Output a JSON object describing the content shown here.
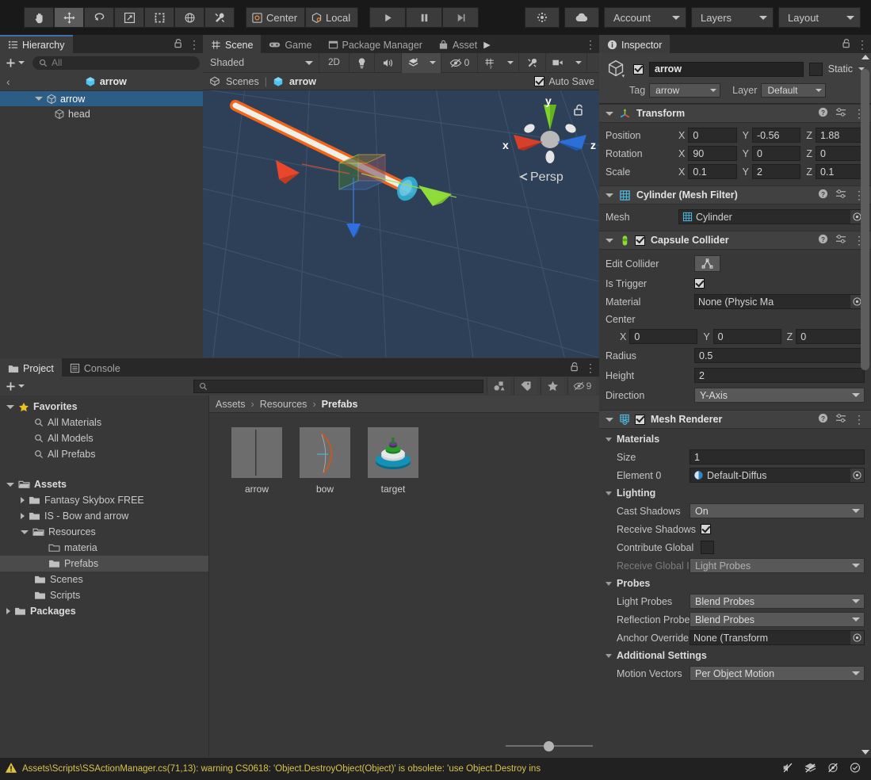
{
  "toolbar": {
    "tools": [
      {
        "name": "hand-tool",
        "icon": "hand",
        "active": false
      },
      {
        "name": "move-tool",
        "icon": "move",
        "active": true
      },
      {
        "name": "rotate-tool",
        "icon": "rotate",
        "active": false
      },
      {
        "name": "scale-tool",
        "icon": "scale",
        "active": false
      },
      {
        "name": "rect-tool",
        "icon": "rect",
        "active": false
      },
      {
        "name": "transform-tool",
        "icon": "transform",
        "active": false
      },
      {
        "name": "custom-tool",
        "icon": "wrench",
        "active": false
      }
    ],
    "pivot_label": "Center",
    "handle_label": "Local",
    "play_label": "play",
    "pause_label": "pause",
    "step_label": "step",
    "collab_label": "collab",
    "cloud_label": "cloud",
    "account_label": "Account",
    "layers_label": "Layers",
    "layout_label": "Layout"
  },
  "hierarchy": {
    "tab_label": "Hierarchy",
    "create_label": "+",
    "search_placeholder": "All",
    "breadcrumb_label": "arrow",
    "items": [
      {
        "label": "arrow",
        "depth": 1,
        "selected": true,
        "expanded": true
      },
      {
        "label": "head",
        "depth": 2,
        "selected": false,
        "expanded": false
      }
    ]
  },
  "scene": {
    "tabs": [
      {
        "label": "Scene",
        "icon": "grid-icon",
        "active": true
      },
      {
        "label": "Game",
        "icon": "gamepad-icon",
        "active": false
      },
      {
        "label": "Package Manager",
        "icon": "package-icon",
        "active": false
      },
      {
        "label": "Asset",
        "icon": "store-icon",
        "active": false
      }
    ],
    "draw_mode": "Shaded",
    "mode_2d": "2D",
    "gizmo_count": "0",
    "breadcrumb_scenes": "Scenes",
    "breadcrumb_scene_name": "arrow",
    "autosave_label": "Auto Save",
    "autosave_checked": true,
    "axis_x": "x",
    "axis_y": "y",
    "axis_z": "z",
    "persp_label": "Persp",
    "background": "#2d4057"
  },
  "inspector": {
    "tab_label": "Inspector",
    "object_name": "arrow",
    "object_enabled": true,
    "static_label": "Static",
    "tag_label": "Tag",
    "tag_value": "arrow",
    "layer_label": "Layer",
    "layer_value": "Default",
    "components": [
      {
        "title": "Transform",
        "icon": "transform-icon",
        "has_checkbox": false,
        "rows": [
          {
            "kind": "vector3",
            "label": "Position",
            "x": "0",
            "y": "-0.56",
            "z": "1.88"
          },
          {
            "kind": "vector3",
            "label": "Rotation",
            "x": "90",
            "y": "0",
            "z": "0"
          },
          {
            "kind": "vector3",
            "label": "Scale",
            "x": "0.1",
            "y": "2",
            "z": "0.1"
          }
        ]
      },
      {
        "title": "Cylinder (Mesh Filter)",
        "icon": "mesh-filter-icon",
        "has_checkbox": false,
        "rows": [
          {
            "kind": "object",
            "label": "Mesh",
            "value": "Cylinder"
          }
        ]
      },
      {
        "title": "Capsule Collider",
        "icon": "capsule-collider-icon",
        "has_checkbox": true,
        "checked": true,
        "rows": [
          {
            "kind": "editcollider",
            "label": "Edit Collider"
          },
          {
            "kind": "checkbox",
            "label": "Is Trigger",
            "checked": true
          },
          {
            "kind": "object",
            "label": "Material",
            "value": "None (Physic Ma"
          },
          {
            "kind": "plainlabel",
            "label": "Center"
          },
          {
            "kind": "vector3inset",
            "label": "",
            "x": "0",
            "y": "0",
            "z": "0"
          },
          {
            "kind": "text",
            "label": "Radius",
            "value": "0.5"
          },
          {
            "kind": "text",
            "label": "Height",
            "value": "2"
          },
          {
            "kind": "dropdown",
            "label": "Direction",
            "value": "Y-Axis"
          }
        ]
      },
      {
        "title": "Mesh Renderer",
        "icon": "mesh-renderer-icon",
        "has_checkbox": true,
        "checked": true,
        "rows": [
          {
            "kind": "group",
            "label": "Materials"
          },
          {
            "kind": "text_ind",
            "label": "Size",
            "value": "1"
          },
          {
            "kind": "object_ind",
            "label": "Element 0",
            "value": "Default-Diffus"
          },
          {
            "kind": "group",
            "label": "Lighting"
          },
          {
            "kind": "dropdown_ind",
            "label": "Cast Shadows",
            "value": "On"
          },
          {
            "kind": "checkbox_ind",
            "label": "Receive Shadows",
            "checked": true
          },
          {
            "kind": "checkbox_ind",
            "label": "Contribute Global",
            "checked": false
          },
          {
            "kind": "dropdown_ind_dim",
            "label": "Receive Global Illu",
            "value": "Light Probes"
          },
          {
            "kind": "group",
            "label": "Probes"
          },
          {
            "kind": "dropdown_ind",
            "label": "Light Probes",
            "value": "Blend Probes"
          },
          {
            "kind": "dropdown_ind",
            "label": "Reflection Probes",
            "value": "Blend Probes"
          },
          {
            "kind": "object_ind",
            "label": "Anchor Override",
            "value": "None (Transform"
          },
          {
            "kind": "group",
            "label": "Additional Settings"
          },
          {
            "kind": "dropdown_ind",
            "label": "Motion Vectors",
            "value": "Per Object Motion"
          }
        ]
      }
    ]
  },
  "project": {
    "tabs": [
      {
        "label": "Project",
        "icon": "folder-icon",
        "active": true
      },
      {
        "label": "Console",
        "icon": "console-icon",
        "active": false
      }
    ],
    "create_label": "+",
    "search_placeholder": "",
    "hidden_count": "9",
    "tree": [
      {
        "label": "Favorites",
        "depth": 0,
        "icon": "star",
        "expanded": true,
        "bold": true,
        "selected": false
      },
      {
        "label": "All Materials",
        "depth": 1,
        "icon": "search",
        "expanded": null,
        "bold": false,
        "selected": false
      },
      {
        "label": "All Models",
        "depth": 1,
        "icon": "search",
        "expanded": null,
        "bold": false,
        "selected": false
      },
      {
        "label": "All Prefabs",
        "depth": 1,
        "icon": "search",
        "expanded": null,
        "bold": false,
        "selected": false
      },
      {
        "label": "",
        "depth": 0,
        "icon": "spacer",
        "expanded": null,
        "bold": false,
        "selected": false
      },
      {
        "label": "Assets",
        "depth": 0,
        "icon": "folder-open",
        "expanded": true,
        "bold": true,
        "selected": false
      },
      {
        "label": "Fantasy Skybox FREE",
        "depth": 1,
        "icon": "folder",
        "expanded": false,
        "bold": false,
        "selected": false
      },
      {
        "label": "IS - Bow and arrow",
        "depth": 1,
        "icon": "folder",
        "expanded": false,
        "bold": false,
        "selected": false
      },
      {
        "label": "Resources",
        "depth": 1,
        "icon": "folder-open",
        "expanded": true,
        "bold": false,
        "selected": false
      },
      {
        "label": "materia",
        "depth": 2,
        "icon": "folder-empty",
        "expanded": null,
        "bold": false,
        "selected": false
      },
      {
        "label": "Prefabs",
        "depth": 2,
        "icon": "folder",
        "expanded": null,
        "bold": false,
        "selected": true
      },
      {
        "label": "Scenes",
        "depth": 1,
        "icon": "folder",
        "expanded": null,
        "bold": false,
        "selected": false
      },
      {
        "label": "Scripts",
        "depth": 1,
        "icon": "folder",
        "expanded": null,
        "bold": false,
        "selected": false
      },
      {
        "label": "Packages",
        "depth": 0,
        "icon": "folder",
        "expanded": false,
        "bold": true,
        "selected": false
      }
    ],
    "breadcrumbs": [
      "Assets",
      "Resources",
      "Prefabs"
    ],
    "assets": [
      {
        "label": "arrow",
        "thumb": "arrow"
      },
      {
        "label": "bow",
        "thumb": "bow"
      },
      {
        "label": "target",
        "thumb": "target"
      }
    ]
  },
  "status": {
    "message": "Assets\\Scripts\\SSActionManager.cs(71,13): warning CS0618: 'Object.DestroyObject(Object)' is obsolete: 'use Object.Destroy ins",
    "warning_color": "#d8c44a",
    "icons": [
      "mute-audio-icon",
      "layers-icon",
      "no-gizmo-icon",
      "ready-icon"
    ]
  }
}
